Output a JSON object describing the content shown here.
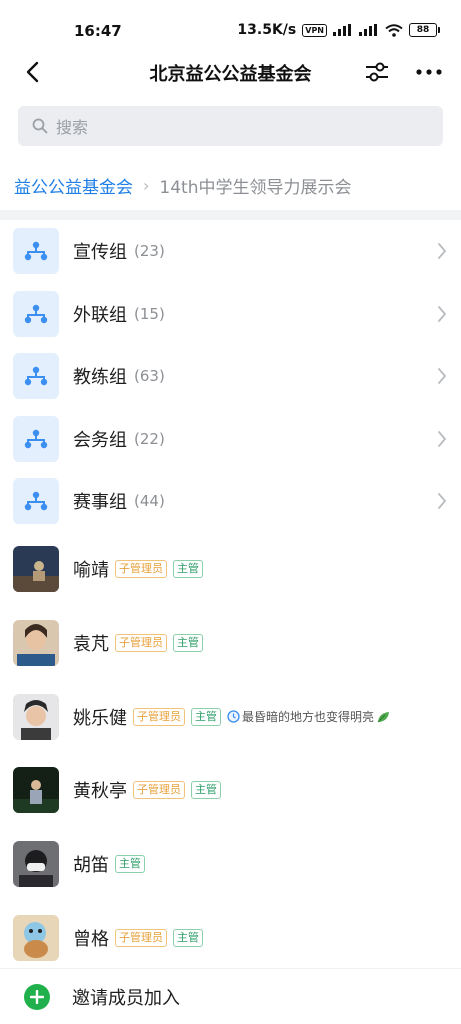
{
  "status_bar": {
    "time": "16:47",
    "speed": "13.5K/s",
    "vpn": "VPN",
    "battery": "88"
  },
  "nav": {
    "title": "北京益公公益基金会"
  },
  "search": {
    "placeholder": "搜索"
  },
  "breadcrumb": {
    "root": "益公公益基金会",
    "separator": "›",
    "current": "14th中学生领导力展示会"
  },
  "groups": [
    {
      "name": "宣传组",
      "count": "(23)"
    },
    {
      "name": "外联组",
      "count": "(15)"
    },
    {
      "name": "教练组",
      "count": "(63)"
    },
    {
      "name": "会务组",
      "count": "(22)"
    },
    {
      "name": "赛事组",
      "count": "(44)"
    }
  ],
  "members": [
    {
      "name": "喻靖",
      "admin_tag": "子管理员",
      "lead_tag": "主管"
    },
    {
      "name": "袁芃",
      "admin_tag": "子管理员",
      "lead_tag": "主管"
    },
    {
      "name": "姚乐健",
      "admin_tag": "子管理员",
      "lead_tag": "主管",
      "status": "最昏暗的地方也变得明亮"
    },
    {
      "name": "黄秋亭",
      "admin_tag": "子管理员",
      "lead_tag": "主管"
    },
    {
      "name": "胡笛",
      "lead_tag": "主管"
    },
    {
      "name": "曾格",
      "admin_tag": "子管理员",
      "lead_tag": "主管"
    }
  ],
  "invite": {
    "label": "邀请成员加入"
  },
  "colors": {
    "accent": "#1f7fe6",
    "group_icon_bg": "#e3effc",
    "admin_tag": "#e8a13a",
    "lead_tag": "#2e9e6a",
    "invite_green": "#21b14c"
  },
  "icons": {
    "back": "chevron-left-icon",
    "filter": "sliders-icon",
    "more": "more-dots-icon",
    "search": "search-icon",
    "group": "org-tree-icon",
    "row": "chevron-right-icon",
    "invite": "plus-circle-icon"
  }
}
